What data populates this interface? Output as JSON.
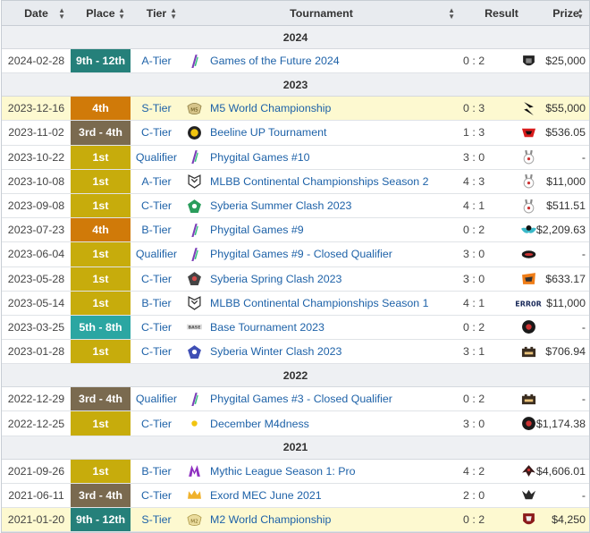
{
  "header": {
    "date": "Date",
    "place": "Place",
    "tier": "Tier",
    "tournament": "Tournament",
    "result": "Result",
    "prize": "Prize"
  },
  "place_colors": {
    "gold": "#c7ac0c",
    "orange": "#d07a09",
    "bronze": "#7a6a4f",
    "teal": "#25807a",
    "teal_light": "#2ba6a2"
  },
  "groups": [
    {
      "year": "2024",
      "rows": [
        {
          "date": "2024-02-28",
          "place": "9th - 12th",
          "pc": "teal",
          "tier": "A-Tier",
          "icon": "fragment-icon",
          "name": "Games of the Future 2024",
          "score": "0 : 2",
          "opp": "shield-team-logo",
          "prize": "$25,000",
          "hl": false
        }
      ]
    },
    {
      "year": "2023",
      "rows": [
        {
          "date": "2023-12-16",
          "place": "4th",
          "pc": "orange",
          "tier": "S-Tier",
          "icon": "mlbb-crest-icon",
          "name": "M5 World Championship",
          "score": "0 : 3",
          "opp": "blacklist-logo",
          "prize": "$55,000",
          "hl": true
        },
        {
          "date": "2023-11-02",
          "place": "3rd - 4th",
          "pc": "bronze",
          "tier": "C-Tier",
          "icon": "beeline-icon",
          "name": "Beeline UP Tournament",
          "score": "1 : 3",
          "opp": "red-team-logo",
          "prize": "$536.05",
          "hl": false
        },
        {
          "date": "2023-10-22",
          "place": "1st",
          "pc": "gold",
          "tier": "Qualifier",
          "icon": "fragment-icon",
          "name": "Phygital Games #10",
          "score": "3 : 0",
          "opp": "rabbit-logo",
          "prize": "-",
          "hl": false
        },
        {
          "date": "2023-10-08",
          "place": "1st",
          "pc": "gold",
          "tier": "A-Tier",
          "icon": "mcc-icon",
          "name": "MLBB Continental Championships Season 2",
          "score": "4 : 3",
          "opp": "rabbit-logo",
          "prize": "$11,000",
          "hl": false
        },
        {
          "date": "2023-09-08",
          "place": "1st",
          "pc": "gold",
          "tier": "C-Tier",
          "icon": "syberia-green-icon",
          "name": "Syberia Summer Clash 2023",
          "score": "4 : 1",
          "opp": "rabbit-logo",
          "prize": "$511.51",
          "hl": false
        },
        {
          "date": "2023-07-23",
          "place": "4th",
          "pc": "orange",
          "tier": "B-Tier",
          "icon": "fragment-icon",
          "name": "Phygital Games #9",
          "score": "0 : 2",
          "opp": "wings-skull-logo",
          "prize": "$2,209.63",
          "hl": false
        },
        {
          "date": "2023-06-04",
          "place": "1st",
          "pc": "gold",
          "tier": "Qualifier",
          "icon": "fragment-icon",
          "name": "Phygital Games #9 - Closed Qualifier",
          "score": "3 : 0",
          "opp": "oval-logo",
          "prize": "-",
          "hl": false
        },
        {
          "date": "2023-05-28",
          "place": "1st",
          "pc": "gold",
          "tier": "C-Tier",
          "icon": "syberia-red-icon",
          "name": "Syberia Spring Clash 2023",
          "score": "3 : 0",
          "opp": "orange-team-logo",
          "prize": "$633.17",
          "hl": false
        },
        {
          "date": "2023-05-14",
          "place": "1st",
          "pc": "gold",
          "tier": "B-Tier",
          "icon": "mcc-icon",
          "name": "MLBB Continental Championships Season 1",
          "score": "4 : 1",
          "opp": "error-logo",
          "prize": "$11,000",
          "hl": false
        },
        {
          "date": "2023-03-25",
          "place": "5th - 8th",
          "pc": "teal_light",
          "tier": "C-Tier",
          "icon": "base-icon",
          "name": "Base Tournament 2023",
          "score": "0 : 2",
          "opp": "round-logo",
          "prize": "-",
          "hl": false
        },
        {
          "date": "2023-01-28",
          "place": "1st",
          "pc": "gold",
          "tier": "C-Tier",
          "icon": "syberia-blue-icon",
          "name": "Syberia Winter Clash 2023",
          "score": "3 : 1",
          "opp": "castle-logo",
          "prize": "$706.94",
          "hl": false
        }
      ]
    },
    {
      "year": "2022",
      "rows": [
        {
          "date": "2022-12-29",
          "place": "3rd - 4th",
          "pc": "bronze",
          "tier": "Qualifier",
          "icon": "fragment-icon",
          "name": "Phygital Games #3 - Closed Qualifier",
          "score": "0 : 2",
          "opp": "castle-logo",
          "prize": "-",
          "hl": false
        },
        {
          "date": "2022-12-25",
          "place": "1st",
          "pc": "gold",
          "tier": "C-Tier",
          "icon": "m4dness-icon",
          "name": "December M4dness",
          "score": "3 : 0",
          "opp": "round-logo",
          "prize": "$1,174.38",
          "hl": false
        }
      ]
    },
    {
      "year": "2021",
      "rows": [
        {
          "date": "2021-09-26",
          "place": "1st",
          "pc": "gold",
          "tier": "B-Tier",
          "icon": "mythic-league-icon",
          "name": "Mythic League Season 1: Pro",
          "score": "4 : 2",
          "opp": "eagle-logo",
          "prize": "$4,606.01",
          "hl": false
        },
        {
          "date": "2021-06-11",
          "place": "3rd - 4th",
          "pc": "bronze",
          "tier": "C-Tier",
          "icon": "mec-crown-icon",
          "name": "Exord MEC June 2021",
          "score": "2 : 0",
          "opp": "wolf-logo",
          "prize": "-",
          "hl": false
        },
        {
          "date": "2021-01-20",
          "place": "9th - 12th",
          "pc": "teal",
          "tier": "S-Tier",
          "icon": "m2-crest-icon",
          "name": "M2 World Championship",
          "score": "0 : 2",
          "opp": "red-shield-logo",
          "prize": "$4,250",
          "hl": true
        }
      ]
    }
  ]
}
